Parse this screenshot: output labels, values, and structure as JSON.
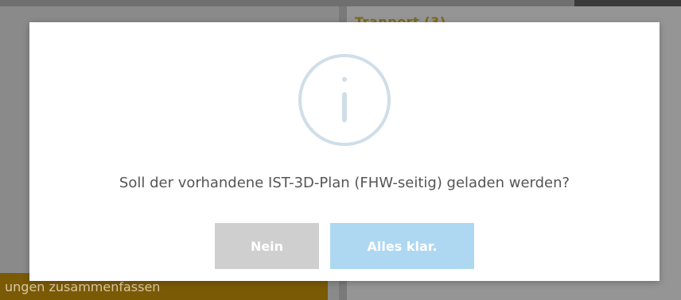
{
  "background": {
    "right_heading": "Tranport (3)",
    "bottom_bar_label": "ungen zusammenfassen"
  },
  "dialog": {
    "icon": "info-circle-icon",
    "message": "Soll der vorhandene IST-3D-Plan (FHW-seitig) geladen werden?",
    "buttons": {
      "no_label": "Nein",
      "confirm_label": "Alles klar."
    }
  },
  "colors": {
    "no_button": "#cfcfcf",
    "confirm_button": "#aed8f1",
    "icon": "#cfdee8",
    "bottom_bar": "#7b5a06"
  }
}
